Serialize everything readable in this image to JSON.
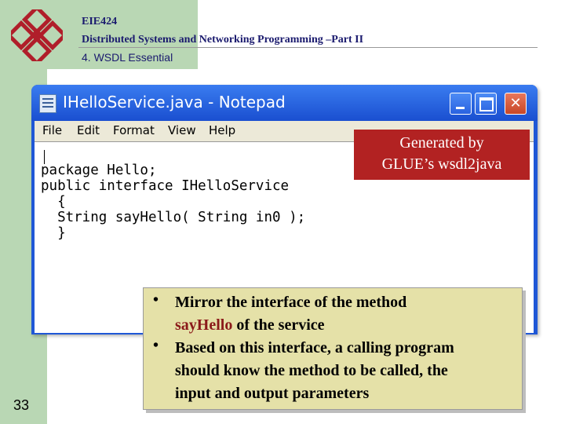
{
  "header": {
    "course_code": "EIE424",
    "course_title": "Distributed Systems and Networking Programming –Part II",
    "section_title": "4. WSDL Essential"
  },
  "page_number": "33",
  "notepad": {
    "title": "IHelloService.java - Notepad",
    "buttons": {
      "minimize": "",
      "maximize": "",
      "close": "✕"
    },
    "menu": [
      "File",
      "Edit",
      "Format",
      "View",
      "Help"
    ],
    "code_lines": [
      "package Hello;",
      "public interface IHelloService",
      "  {",
      "  String sayHello( String in0 );",
      "  }"
    ]
  },
  "callout": {
    "line1": "Generated by",
    "line2": "GLUE’s wsdl2java"
  },
  "bullets": {
    "b1_prefix": "Mirror the interface of the method",
    "b1_highlight": "sayHello",
    "b1_suffix": " of the service",
    "b2_line1": "Based on this interface, a calling program",
    "b2_line2": "should know the method to be called, the",
    "b2_line3": "input and output parameters",
    "marker": "•"
  },
  "colors": {
    "side_band": "#b9d7b4",
    "logo": "#b01e2a",
    "callout_bg": "#b22222",
    "bullet_box_bg": "#e5e1a8",
    "highlight": "#8b1a1a",
    "titlebar": "#2a62e0"
  },
  "icons": [
    "polyu-logo",
    "notepad-app-icon",
    "minimize-icon",
    "maximize-icon",
    "close-icon"
  ]
}
